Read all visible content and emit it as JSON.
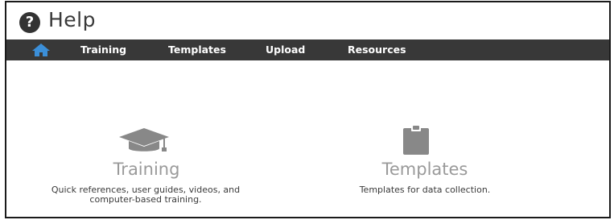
{
  "header": {
    "title": "Help",
    "icon": "help-circle-icon"
  },
  "nav": {
    "home_icon": "home-icon",
    "items": [
      {
        "label": "Training"
      },
      {
        "label": "Templates"
      },
      {
        "label": "Upload"
      },
      {
        "label": "Resources"
      }
    ],
    "background_color": "#383838",
    "home_icon_color": "#3b8fd9"
  },
  "tiles": [
    {
      "icon": "graduation-cap-icon",
      "title": "Training",
      "description": "Quick references, user guides, videos, and computer-based training."
    },
    {
      "icon": "clipboard-icon",
      "title": "Templates",
      "description": "Templates for data collection."
    }
  ],
  "colors": {
    "tile_icon": "#888888",
    "tile_title": "#9a9a9a"
  }
}
